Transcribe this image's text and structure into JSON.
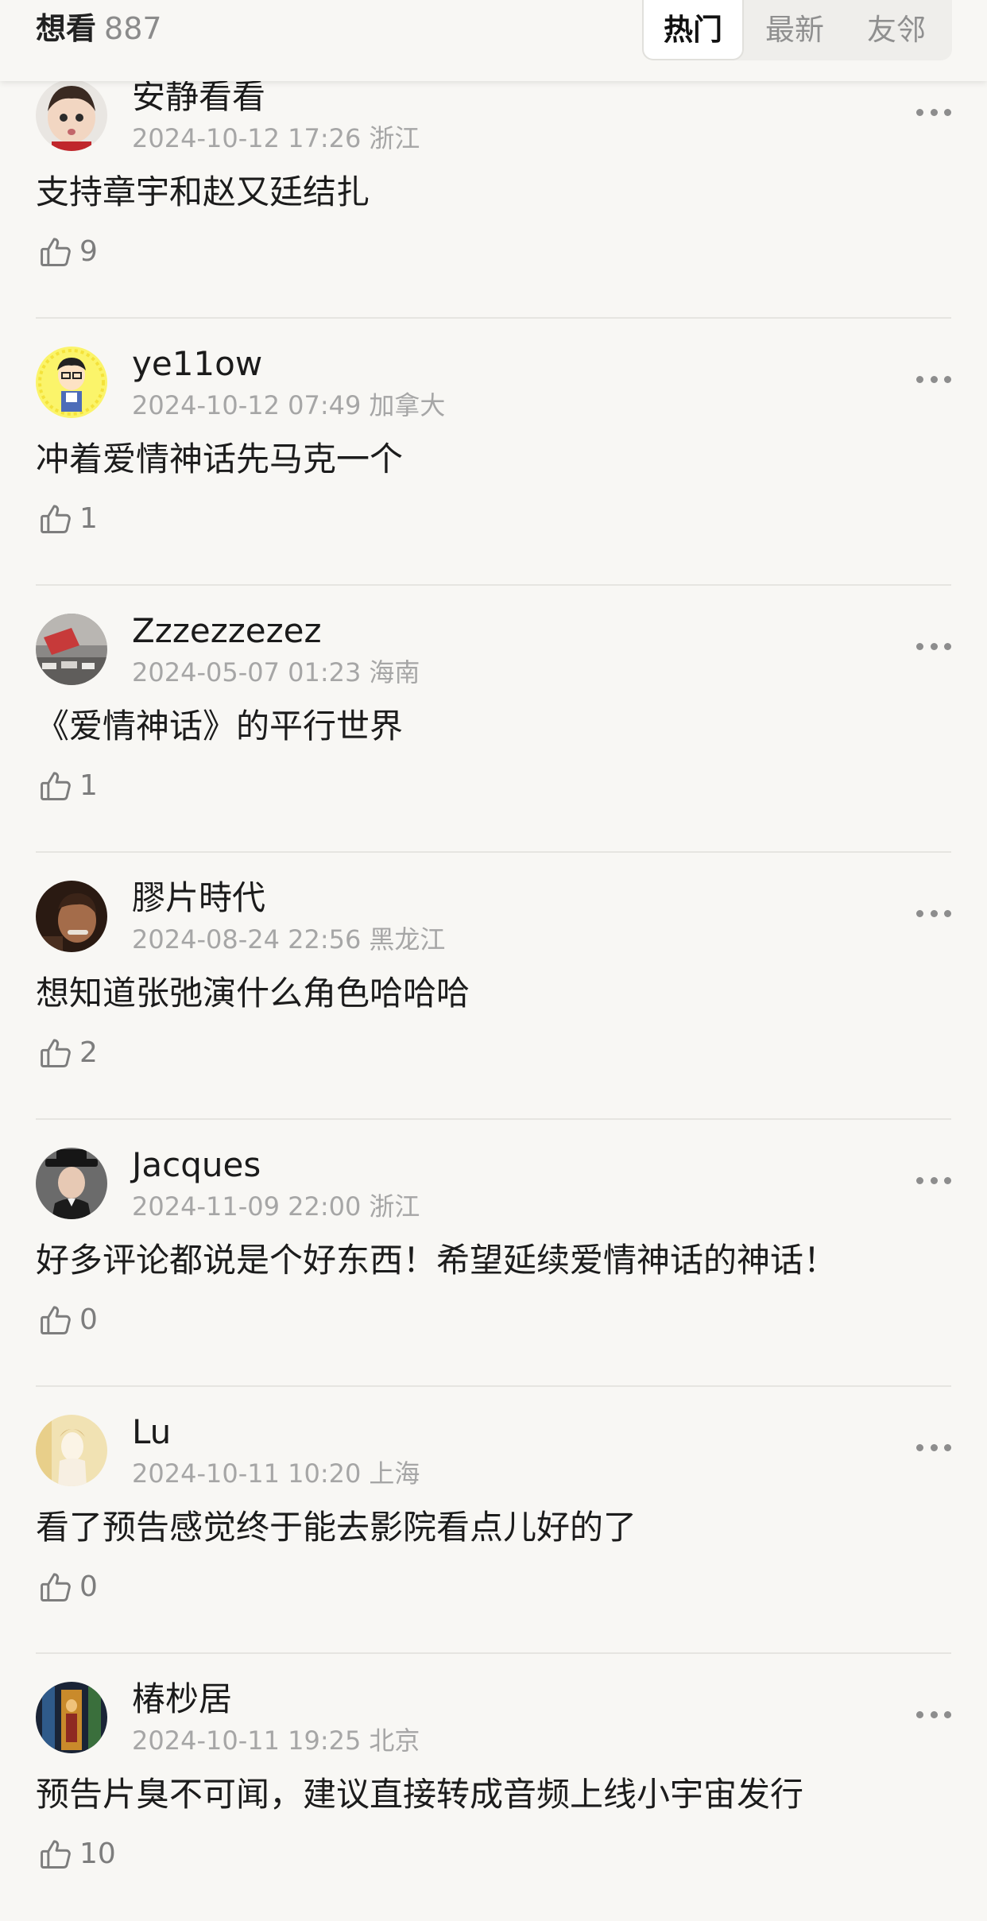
{
  "header": {
    "label": "想看",
    "count": "887",
    "tabs": [
      {
        "label": "热门",
        "active": true
      },
      {
        "label": "最新",
        "active": false
      },
      {
        "label": "友邻",
        "active": false
      }
    ]
  },
  "comments": [
    {
      "username": "安静看看",
      "time": "2024-10-12 17:26",
      "location": "浙江",
      "content": "支持章宇和赵又廷结扎",
      "likes": "9"
    },
    {
      "username": "ye11ow",
      "time": "2024-10-12 07:49",
      "location": "加拿大",
      "content": "冲着爱情神话先马克一个",
      "likes": "1"
    },
    {
      "username": "Zzzezzezez",
      "time": "2024-05-07 01:23",
      "location": "海南",
      "content": "《爱情神话》的平行世界",
      "likes": "1"
    },
    {
      "username": "膠片時代",
      "time": "2024-08-24 22:56",
      "location": "黑龙江",
      "content": "想知道张弛演什么角色哈哈哈",
      "likes": "2"
    },
    {
      "username": "Jacques",
      "time": "2024-11-09 22:00",
      "location": "浙江",
      "content": "好多评论都说是个好东西！希望延续爱情神话的神话！",
      "likes": "0"
    },
    {
      "username": "Lu",
      "time": "2024-10-11 10:20",
      "location": "上海",
      "content": "看了预告感觉终于能去影院看点儿好的了",
      "likes": "0"
    },
    {
      "username": "椿杪居",
      "time": "2024-10-11 19:25",
      "location": "北京",
      "content": "预告片臭不可闻，建议直接转成音频上线小宇宙发行",
      "likes": "10"
    }
  ],
  "colors": {
    "background": "#f8f7f4",
    "meta_text": "#a6a6a6",
    "active_tab_bg": "#ffffff"
  }
}
